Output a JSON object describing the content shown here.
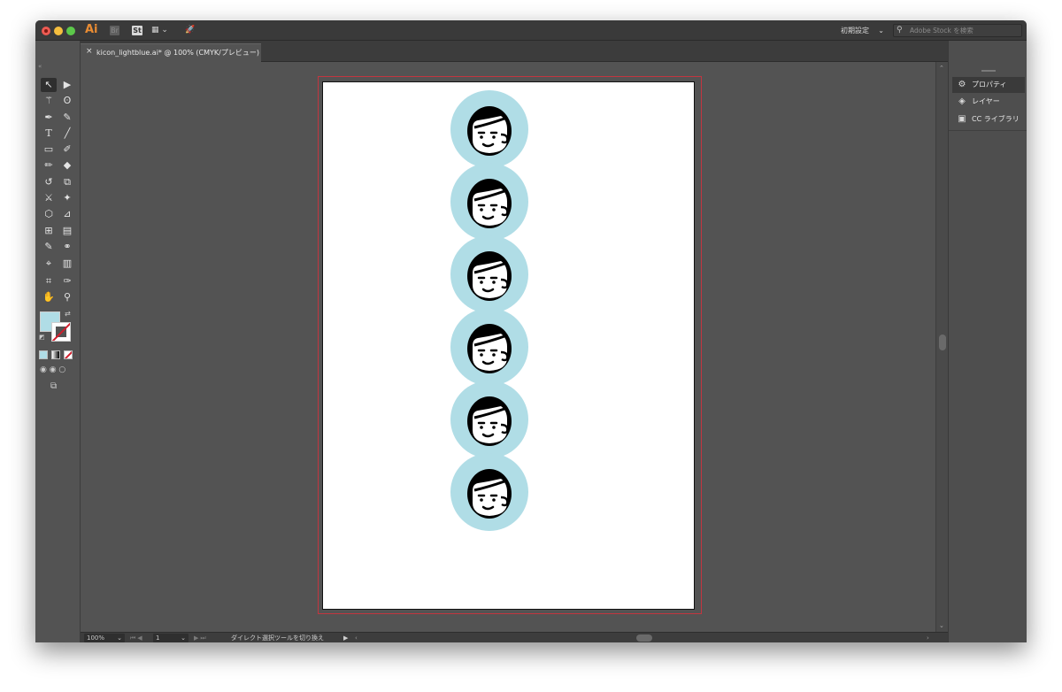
{
  "app": {
    "logo": "Ai",
    "bridge_label": "Br",
    "stock_label": "St",
    "arrange_icon": "arrange-documents-icon",
    "gpu_icon": "gpu-performance-icon"
  },
  "header": {
    "workspace_label": "初期設定",
    "stock_search_placeholder": "Adobe Stock を検索"
  },
  "document": {
    "tab_title": "kicon_lightblue.ai* @ 100% (CMYK/プレビュー)",
    "fill_color": "#b0dde6",
    "icon_count": 6
  },
  "right_panel": {
    "items": [
      {
        "label": "プロパティ",
        "icon": "properties-icon"
      },
      {
        "label": "レイヤー",
        "icon": "layers-icon"
      },
      {
        "label": "CC ライブラリ",
        "icon": "cc-libraries-icon"
      }
    ]
  },
  "status_bar": {
    "zoom": "100%",
    "artboard": "1",
    "status_text": "ダイレクト選択ツールを切り換え"
  },
  "colors": {
    "accent_orange": "#e98c33",
    "bleed_red": "#c23640",
    "circle_blue": "#b0dde6"
  }
}
